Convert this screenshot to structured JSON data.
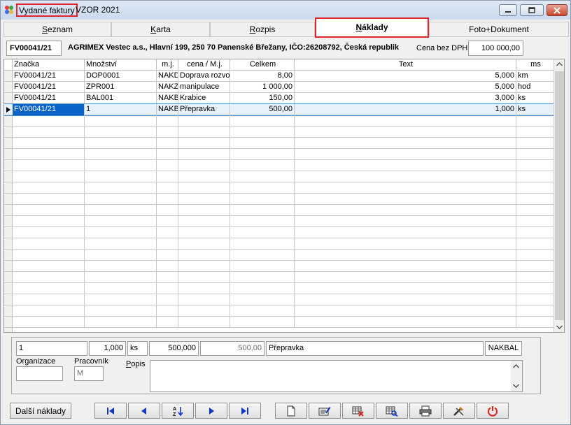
{
  "window": {
    "title_highlight": "Vydané faktury",
    "title_rest": "VZOR  2021",
    "controls": [
      "minimize-icon",
      "maximize-icon",
      "close-icon"
    ]
  },
  "tabs": [
    {
      "label": "Seznam",
      "underline": "S",
      "rest": "eznam"
    },
    {
      "label": "Karta",
      "underline": "K",
      "rest": "arta"
    },
    {
      "label": "Rozpis",
      "underline": "R",
      "rest": "ozpis"
    },
    {
      "label": "Náklady",
      "underline": "N",
      "rest": "áklady",
      "active": true
    },
    {
      "label": "Foto+Dokument"
    }
  ],
  "header": {
    "doc_number": "FV00041/21",
    "company": "AGRIMEX Vestec a.s., Hlavní 199, 250 70 Panenské Břežany, IČO:26208792, Česká republik",
    "cena_label": "Cena bez DPH",
    "cena_value": "100 000,00"
  },
  "grid": {
    "columns": [
      "Značka",
      "Množství",
      "m.j.",
      "cena / M.j.",
      "Celkem",
      "Text",
      "ms"
    ],
    "rows": [
      {
        "znacka": "FV00041/21",
        "mnozstvi": "DOP0001",
        "mj": "NAKD",
        "cena": "Doprava rozvo",
        "celkem": "8,00",
        "text": "5,000",
        "ms": "km"
      },
      {
        "znacka": "FV00041/21",
        "mnozstvi": "ZPR001",
        "mj": "NAKZ",
        "cena": "manipulace",
        "celkem": "1 000,00",
        "text": "5,000",
        "ms": "hod"
      },
      {
        "znacka": "FV00041/21",
        "mnozstvi": "BAL001",
        "mj": "NAKB",
        "cena": "Krabice",
        "celkem": "150,00",
        "text": "3,000",
        "ms": "ks"
      },
      {
        "znacka": "FV00041/21",
        "mnozstvi": "1",
        "mj": "NAKB",
        "cena": "Přepravka",
        "celkem": "500,00",
        "text": "1,000",
        "ms": "ks",
        "selected": true
      }
    ]
  },
  "detail": {
    "kod": "1",
    "mnozstvi": "1,000",
    "mj": "ks",
    "cena": "500,000",
    "celkem": "500,00",
    "nazev": "Přepravka",
    "typ": "NAKBAL",
    "organizace_label": "Organizace",
    "organizace_value": "",
    "pracovnik_label": "Pracovník",
    "pracovnik_value": "M",
    "popis_label": "Popis",
    "popis_value": ""
  },
  "toolbar": {
    "dalsi_label": "Další náklady",
    "buttons": [
      "first-record-icon",
      "prev-record-icon",
      "sort-az-icon",
      "next-record-icon",
      "last-record-icon",
      "new-document-icon",
      "edit-icon",
      "delete-icon",
      "search-records-icon",
      "print-icon",
      "tools-icon",
      "power-icon"
    ]
  },
  "colors": {
    "highlight_red": "#e0242a",
    "selection_blue": "#0a64c8",
    "nav_blue": "#1037c8",
    "power_red": "#e02020"
  }
}
